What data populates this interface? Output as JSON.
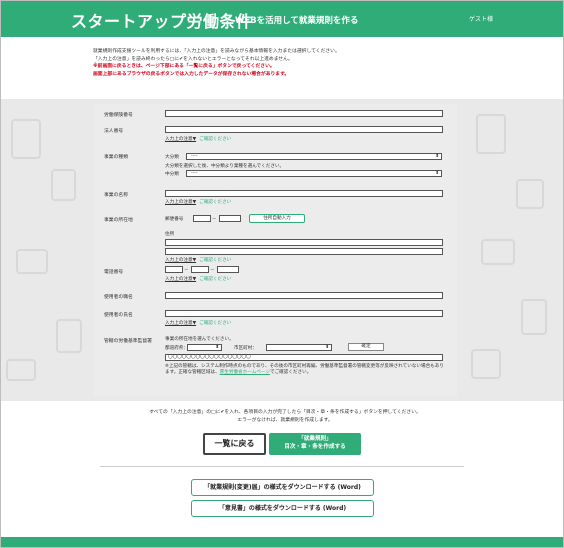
{
  "header": {
    "title": "スタートアップ労働条件",
    "subtitle": "WEBを活用して就業規則を作る",
    "guest": "ゲスト様"
  },
  "notice": {
    "line1": "就業規則作成支援ツールを利用するには、「入力上の注意」を読みながら基本情報を入力または選択してください。",
    "line2": "「入力上の注意」を読み終わったら□に✔を入れないとエラーとなってそれ以上進めません。",
    "warn1": "※前画面に戻るときは、ページ下部にある「一覧に戻る」ボタンで戻ってください。",
    "warn2": "画面上部にあるブラウザの戻るボタンでは入力したデータが保存されない場合があります。"
  },
  "form": {
    "insurance_no": "労働保険番号",
    "corp_no": "法人番号",
    "check_label": "入力上の注意▼",
    "check_confirm": "ご確認ください",
    "business_type": "事業の種類",
    "major": "大分類",
    "major_value": "----",
    "major_hint": "大分類を選択した後、中分類より業種を選んでください。",
    "minor": "中分類",
    "minor_value": "----",
    "business_name": "事業の名称",
    "location": "事業の所在地",
    "postal": "郵便番号",
    "dash": "－",
    "auto_address": "住所自動入力",
    "address": "住所",
    "phone": "電話番号",
    "employer_title": "使用者の職名",
    "employer_name": "使用者の氏名",
    "office": "管轄の労働基準監督署",
    "office_hint": "事業の所在地を選んでください。",
    "prefecture": "都道府県：",
    "prefecture_value": "",
    "city": "市区町村：",
    "city_value": "",
    "confirm_button": "確定",
    "office_value": "〇〇〇〇〇〇〇〇〇〇〇〇〇〇〇〇〇〇",
    "office_note1": "※上記の管轄は、システム制作時点のものであり、その後の市区町村再編、労働基準監督署の管轄変更等が反映されていない場合もあります。正確な管轄区域は、",
    "office_note_link": "厚生労働省ホームページ",
    "office_note2": "でご確認ください。"
  },
  "footer": {
    "instr1": "すべての「入力上の注意」の□に✔を入れ、各項目の入力が完了したら「目次・章・条を作成する」ボタンを押してください。",
    "instr2": "エラーがなければ、就業規則を作成します。",
    "back_button": "一覧に戻る",
    "create_line1": "「就業規則」",
    "create_line2": "目次・章・条を作成する",
    "download1": "「就業規則(変更)届」の様式をダウンロードする (Word)",
    "download2": "「意見書」の様式をダウンロードする (Word)"
  },
  "colors": {
    "brand": "#2fac78",
    "warning": "#d0021b"
  }
}
